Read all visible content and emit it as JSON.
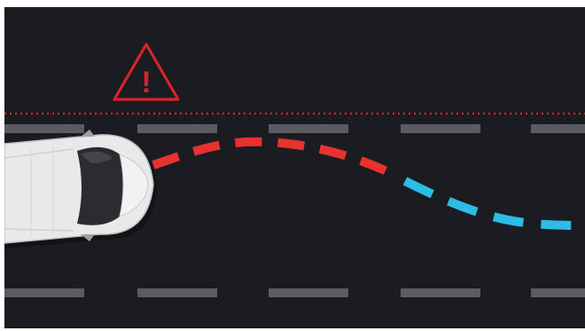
{
  "scene": {
    "description_label": "",
    "warning": {
      "icon": "warning-triangle-icon",
      "glyph": "!",
      "color": "#d3262b"
    },
    "colors": {
      "road": "#1a1c22",
      "lane_dash": "#5a5c62",
      "boundary_dots": "#d3262b",
      "path_danger": "#e8322f",
      "path_safe": "#2cbde4",
      "vehicle_body": "#e9e9ea"
    },
    "vehicle": {
      "type": "van",
      "icon": "van-topview-icon"
    },
    "path": {
      "segments": [
        "danger",
        "safe"
      ]
    }
  }
}
